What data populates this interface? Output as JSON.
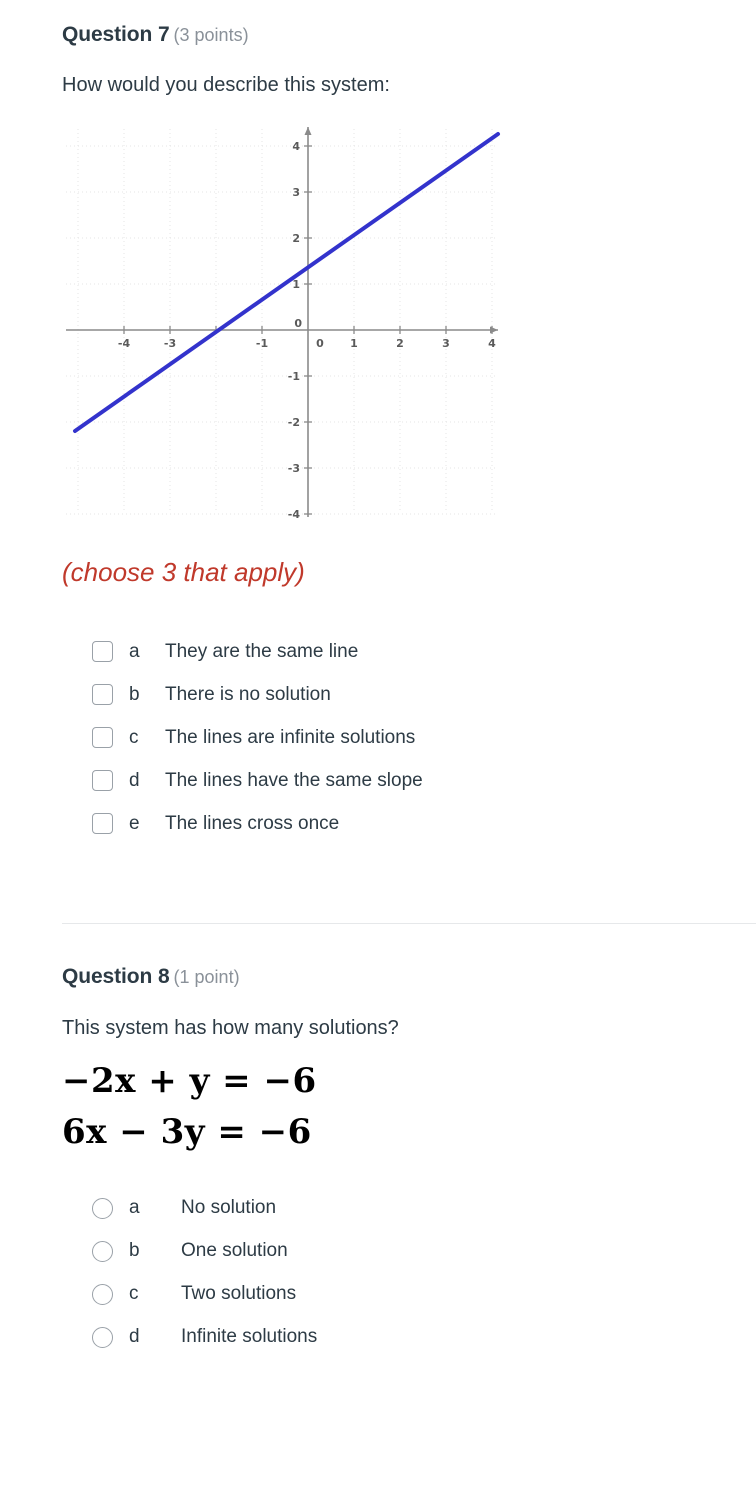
{
  "page": {
    "background": "#ffffff",
    "text_color": "#2d3b45",
    "accent_red": "#c0392b",
    "line_color": "#3333cc"
  },
  "question7": {
    "title": "Question 7",
    "points": "(3 points)",
    "prompt": "How would you describe this system:",
    "choose_note": "(choose 3 that apply)",
    "options": [
      {
        "letter": "a",
        "text": "They are the same line"
      },
      {
        "letter": "b",
        "text": "There is no solution"
      },
      {
        "letter": "c",
        "text": "The lines are infinite solutions"
      },
      {
        "letter": "d",
        "text": "The lines have the same slope"
      },
      {
        "letter": "e",
        "text": "The lines cross once"
      }
    ]
  },
  "chart_data": {
    "type": "line",
    "title": "",
    "xlabel": "",
    "ylabel": "",
    "xlim": [
      -4.7,
      4.7
    ],
    "ylim": [
      -4.5,
      4.6
    ],
    "grid": true,
    "grid_style": "dotted",
    "x_ticks": [
      -4,
      -3,
      -2,
      -1,
      0,
      1,
      2,
      3,
      4
    ],
    "x_tick_labels": [
      "-4",
      "-3",
      "",
      "-1",
      "0",
      "1",
      "2",
      "3",
      "4"
    ],
    "y_ticks": [
      -4,
      -3,
      -2,
      -1,
      0,
      1,
      2,
      3,
      4
    ],
    "y_tick_labels": [
      "-4",
      "-3",
      "-2",
      "-1",
      "0",
      "1",
      "2",
      "3",
      "4"
    ],
    "axis_color": "#808080",
    "series": [
      {
        "name": "line",
        "color": "#3333cc",
        "slope": 0.7,
        "intercept": 1,
        "x": [
          -4.55,
          4.7
        ],
        "y": [
          -2.2,
          4.3
        ]
      }
    ]
  },
  "question8": {
    "title": "Question 8",
    "points": "(1 point)",
    "prompt": "This system has how many solutions?",
    "equations": [
      "−2x + y = −6",
      "6x − 3y = −6"
    ],
    "options": [
      {
        "letter": "a",
        "text": "No solution"
      },
      {
        "letter": "b",
        "text": "One solution"
      },
      {
        "letter": "c",
        "text": "Two solutions"
      },
      {
        "letter": "d",
        "text": "Infinite solutions"
      }
    ]
  }
}
